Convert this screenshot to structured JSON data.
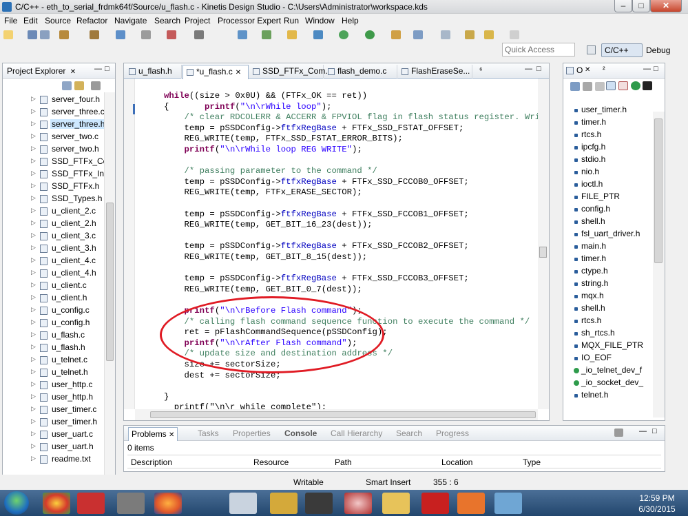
{
  "window": {
    "title": "C/C++ - eth_to_serial_frdmk64f/Source/u_flash.c - Kinetis Design Studio - C:\\Users\\Administrator\\workspace.kds",
    "minimize": "–",
    "maximize": "□",
    "close": "✕"
  },
  "menu": [
    "File",
    "Edit",
    "Source",
    "Refactor",
    "Navigate",
    "Search",
    "Project",
    "Processor Expert",
    "Run",
    "Window",
    "Help"
  ],
  "quick_access": {
    "placeholder": "Quick Access"
  },
  "perspectives": {
    "cpp": "C/C++",
    "debug": "Debug"
  },
  "project_explorer": {
    "title": "Project Explorer",
    "close": "✕",
    "items": [
      {
        "label": "server_four.h",
        "selected": false
      },
      {
        "label": "server_three.c",
        "selected": false
      },
      {
        "label": "server_three.h",
        "selected": true
      },
      {
        "label": "server_two.c",
        "selected": false
      },
      {
        "label": "server_two.h",
        "selected": false
      },
      {
        "label": "SSD_FTFx_Com",
        "selected": false
      },
      {
        "label": "SSD_FTFx_Inter",
        "selected": false
      },
      {
        "label": "SSD_FTFx.h",
        "selected": false
      },
      {
        "label": "SSD_Types.h",
        "selected": false
      },
      {
        "label": "u_client_2.c",
        "selected": false
      },
      {
        "label": "u_client_2.h",
        "selected": false
      },
      {
        "label": "u_client_3.c",
        "selected": false
      },
      {
        "label": "u_client_3.h",
        "selected": false
      },
      {
        "label": "u_client_4.c",
        "selected": false
      },
      {
        "label": "u_client_4.h",
        "selected": false
      },
      {
        "label": "u_client.c",
        "selected": false
      },
      {
        "label": "u_client.h",
        "selected": false
      },
      {
        "label": "u_config.c",
        "selected": false
      },
      {
        "label": "u_config.h",
        "selected": false
      },
      {
        "label": "u_flash.c",
        "selected": false
      },
      {
        "label": "u_flash.h",
        "selected": false
      },
      {
        "label": "u_telnet.c",
        "selected": false
      },
      {
        "label": "u_telnet.h",
        "selected": false
      },
      {
        "label": "user_http.c",
        "selected": false
      },
      {
        "label": "user_http.h",
        "selected": false
      },
      {
        "label": "user_timer.c",
        "selected": false
      },
      {
        "label": "user_timer.h",
        "selected": false
      },
      {
        "label": "user_uart.c",
        "selected": false
      },
      {
        "label": "user_uart.h",
        "selected": false
      },
      {
        "label": "readme.txt",
        "selected": false
      }
    ]
  },
  "editor": {
    "tabs": [
      "u_flash.h",
      "*u_flash.c",
      "SSD_FTFx_Com...",
      "flash_demo.c",
      "FlashEraseSe..."
    ],
    "overflow": "⁶",
    "active_tab": 1
  },
  "code": [
    [
      [
        "kw",
        "while"
      ],
      [
        "",
        "((size > 0x0U) && (FTFx_OK == ret))"
      ]
    ],
    [
      [
        "",
        "{\t"
      ],
      [
        "kw",
        "printf"
      ],
      [
        "",
        "("
      ],
      [
        "str",
        "\"\\n\\rWhile loop\""
      ],
      [
        "",
        ");"
      ]
    ],
    [
      [
        "cm",
        "    /* clear RDCOLERR & ACCERR & FPVIOL flag in flash status register. Write"
      ]
    ],
    [
      [
        "",
        "    temp = pSSDConfig->"
      ],
      [
        "fld",
        "ftfxRegBase"
      ],
      [
        "",
        ": + FTFx_SSD_FSTAT_OFFSET;"
      ]
    ],
    [
      [
        "",
        "    REG_WRITE(temp, FTFx_SSD_FSTAT_ERROR_BITS);"
      ]
    ],
    [
      [
        "",
        "    "
      ],
      [
        "kw",
        "printf"
      ],
      [
        "",
        "("
      ],
      [
        "str",
        "\"\\n\\rWhile loop REG WRITE\""
      ],
      [
        "",
        ");"
      ]
    ],
    [
      [
        "",
        "",
        ""
      ]
    ],
    [
      [
        "cm",
        "    /* passing parameter to the command */"
      ]
    ],
    [
      [
        "",
        "    temp = pSSDConfig->"
      ],
      [
        "fld",
        "ftfxRegBase"
      ],
      [
        "",
        " + FTFx_SSD_FCCOB0_OFFSET;"
      ]
    ],
    [
      [
        "",
        "    REG_WRITE(temp, FTFx_ERASE_SECTOR);"
      ]
    ],
    [
      [
        "",
        ""
      ]
    ],
    [
      [
        "",
        "    temp = pSSDConfig->"
      ],
      [
        "fld",
        "ftfxRegBase"
      ],
      [
        "",
        " + FTFx_SSD_FCCOB1_OFFSET;"
      ]
    ],
    [
      [
        "",
        "    REG_WRITE(temp, GET_BIT_16_23(dest));"
      ]
    ],
    [
      [
        "",
        ""
      ]
    ],
    [
      [
        "",
        "    temp = pSSDConfig->"
      ],
      [
        "fld",
        "ftfxRegBase"
      ],
      [
        "",
        " + FTFx_SSD_FCCOB2_OFFSET;"
      ]
    ],
    [
      [
        "",
        "    REG_WRITE(temp, GET_BIT_8_15(dest));"
      ]
    ],
    [
      [
        "",
        ""
      ]
    ],
    [
      [
        "",
        "    temp = pSSDConfig->"
      ],
      [
        "fld",
        "ftfxRegBase"
      ],
      [
        "",
        " + FTFx_SSD_FCCOB3_OFFSET;"
      ]
    ],
    [
      [
        "",
        "    REG_WRITE(temp, GET_BIT_0_7(dest));"
      ]
    ],
    [
      [
        "",
        ""
      ]
    ],
    [
      [
        "",
        "    "
      ],
      [
        "kw",
        "printf"
      ],
      [
        "",
        "("
      ],
      [
        "str",
        "\"\\n\\rBefore Flash command\""
      ],
      [
        "",
        ");"
      ]
    ],
    [
      [
        "cm",
        "    /* calling flash command sequence function to execute the command */"
      ]
    ],
    [
      [
        "",
        "    ret = pFlashCommandSequence(pSSDConfig);"
      ]
    ],
    [
      [
        "",
        "    "
      ],
      [
        "kw",
        "printf"
      ],
      [
        "",
        "("
      ],
      [
        "str",
        "\"\\n\\rAfter Flash command\""
      ],
      [
        "",
        ");"
      ]
    ],
    [
      [
        "cm",
        "    /* update size and destination address */"
      ]
    ],
    [
      [
        "",
        "    size += sectorSize;"
      ]
    ],
    [
      [
        "",
        "    dest += sectorSize;"
      ]
    ],
    [
      [
        "",
        ""
      ]
    ],
    [
      [
        "",
        "}"
      ]
    ],
    [
      [
        "",
        "  printf(\"\\n\\r while complete\");"
      ]
    ]
  ],
  "outline": {
    "title": "O",
    "overflow": "²",
    "items": [
      "user_timer.h",
      "timer.h",
      "rtcs.h",
      "ipcfg.h",
      "stdio.h",
      "nio.h",
      "ioctl.h",
      "FILE_PTR",
      "config.h",
      "shell.h",
      "fsl_uart_driver.h",
      "main.h",
      "timer.h",
      "ctype.h",
      "string.h",
      "mqx.h",
      "shell.h",
      "rtcs.h",
      "sh_rtcs.h",
      "MQX_FILE_PTR",
      "IO_EOF",
      "_io_telnet_dev_f",
      "_io_socket_dev_",
      "telnet.h"
    ]
  },
  "bottom": {
    "tabs": [
      "Problems",
      "Tasks",
      "Properties",
      "Console",
      "Call Hierarchy",
      "Search",
      "Progress"
    ],
    "items_count": "0 items",
    "columns": [
      "Description",
      "Resource",
      "Path",
      "Location",
      "Type"
    ]
  },
  "status": {
    "writable": "Writable",
    "insert_mode": "Smart Insert",
    "position": "355 : 6"
  },
  "clock": {
    "time": "12:59 PM",
    "date": "6/30/2015"
  },
  "colors": {
    "keyword": "#7f0055",
    "string": "#2a00ff",
    "comment": "#3f7f5f",
    "field": "#0000c0",
    "annotation": "#e01b24"
  }
}
